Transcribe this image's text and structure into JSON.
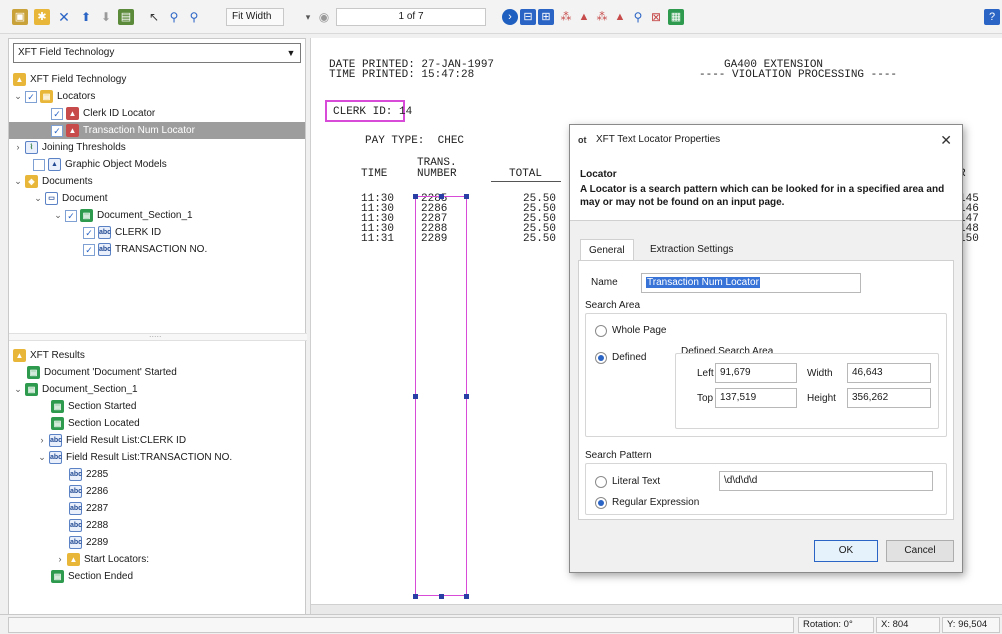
{
  "toolbar": {
    "fit_label": "Fit Width",
    "page_indicator": "1 of 7"
  },
  "left_panel": {
    "combo_value": "XFT Field Technology",
    "tree": [
      {
        "label": "XFT Field Technology"
      },
      {
        "label": "Locators"
      },
      {
        "label": "Clerk ID Locator"
      },
      {
        "label": "Transaction Num Locator"
      },
      {
        "label": "Joining Thresholds"
      },
      {
        "label": "Graphic Object Models"
      },
      {
        "label": "Documents"
      },
      {
        "label": "Document"
      },
      {
        "label": "Document_Section_1"
      },
      {
        "label": "CLERK ID"
      },
      {
        "label": "TRANSACTION NO."
      }
    ],
    "results": [
      {
        "label": "XFT Results"
      },
      {
        "label": "Document 'Document' Started"
      },
      {
        "label": "Document_Section_1"
      },
      {
        "label": "Section Started"
      },
      {
        "label": "Section Located"
      },
      {
        "label": "Field Result List:CLERK ID"
      },
      {
        "label": "Field Result List:TRANSACTION NO."
      },
      {
        "label": "2285"
      },
      {
        "label": "2286"
      },
      {
        "label": "2287"
      },
      {
        "label": "2288"
      },
      {
        "label": "2289"
      },
      {
        "label": "Start Locators:"
      },
      {
        "label": "Section Ended"
      }
    ],
    "splitter_grip": "....."
  },
  "document": {
    "date_line": "DATE PRINTED: 27-JAN-1997",
    "time_line": "TIME PRINTED: 15:47:28",
    "ext_line": "GA400 EXTENSION",
    "viol_line": "---- VIOLATION PROCESSING ----",
    "clerk_line": "CLERK ID: 14",
    "paytype_line": "PAY TYPE:  CHEC",
    "col_time": "TIME",
    "col_trans_1": "TRANS.",
    "col_trans_2": "NUMBER",
    "col_total": "TOTAL",
    "col_r": "R",
    "rows": [
      {
        "time": "11:30",
        "number": "2285",
        "total": "25.50",
        "tail": "145"
      },
      {
        "time": "11:30",
        "number": "2286",
        "total": "25.50",
        "tail": "146"
      },
      {
        "time": "11:30",
        "number": "2287",
        "total": "25.50",
        "tail": "147"
      },
      {
        "time": "11:30",
        "number": "2288",
        "total": "25.50",
        "tail": "148"
      },
      {
        "time": "11:31",
        "number": "2289",
        "total": "25.50",
        "tail": "150"
      }
    ]
  },
  "dialog": {
    "logo": "ot",
    "title": "XFT Text Locator Properties",
    "close": "✕",
    "header_title": "Locator",
    "header_desc": "A Locator is a search pattern which can be looked for in a specified area and may or may not be found on an input page.",
    "tabs": [
      "General",
      "Extraction Settings"
    ],
    "name_label": "Name",
    "name_value": "Transaction Num Locator",
    "search_area_label": "Search Area",
    "whole_page_label": "Whole Page",
    "defined_label": "Defined",
    "defined_area_label": "Defined Search Area",
    "left_label": "Left",
    "left_value": "91,679",
    "width_label": "Width",
    "width_value": "46,643",
    "top_label": "Top",
    "top_value": "137,519",
    "height_label": "Height",
    "height_value": "356,262",
    "search_pattern_label": "Search Pattern",
    "literal_label": "Literal Text",
    "literal_value": "\\d\\d\\d\\d",
    "regex_label": "Regular Expression",
    "ok_label": "OK",
    "cancel_label": "Cancel"
  },
  "statusbar": {
    "rotation": "Rotation: 0°",
    "x": "X: 804",
    "y": "Y: 96,504"
  }
}
